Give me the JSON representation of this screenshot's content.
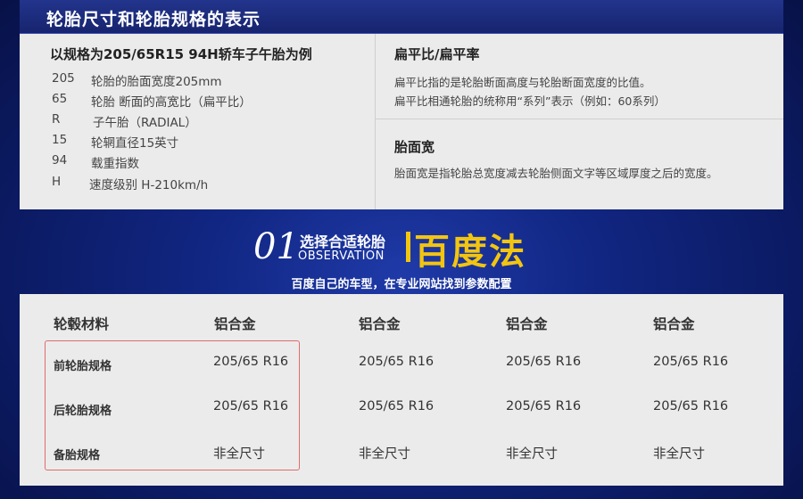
{
  "header": {
    "title": "轮胎尺寸和轮胎规格的表示"
  },
  "example": {
    "title": "以规格为205/65R15 94H轿车子午胎为例",
    "rows": [
      {
        "code": "205",
        "desc": "轮胎的胎面宽度205mm"
      },
      {
        "code": "65",
        "desc": "轮胎 断面的高宽比（扁平比）"
      },
      {
        "code": "R",
        "desc": "子午胎（RADIAL）"
      },
      {
        "code": "15",
        "desc": "轮辋直径15英寸"
      },
      {
        "code": "94",
        "desc": "载重指数"
      },
      {
        "code": "H",
        "desc": "速度级别 H-210km/h"
      }
    ]
  },
  "aspect_ratio": {
    "title": "扁平比/扁平率",
    "lines": [
      "扁平比指的是轮胎断面高度与轮胎断面宽度的比值。",
      "扁平比相通轮胎的统称用“系列”表示（例如：60系列）"
    ]
  },
  "tread_width": {
    "title": "胎面宽",
    "text": "胎面宽是指轮胎总宽度减去轮胎侧面文字等区域厚度之后的宽度。"
  },
  "banner": {
    "number": "01",
    "title_cn": "选择合适轮胎",
    "title_en": "OBSERVATION",
    "highlight": "百度法",
    "subtitle": "百度自己的车型，在专业网站找到参数配置"
  },
  "spec_table": {
    "header": [
      "轮毂材料",
      "铝合金",
      "铝合金",
      "铝合金",
      "铝合金"
    ],
    "rows": [
      {
        "label": "前轮胎规格",
        "values": [
          "205/65 R16",
          "205/65 R16",
          "205/65 R16",
          "205/65 R16"
        ]
      },
      {
        "label": "后轮胎规格",
        "values": [
          "205/65 R16",
          "205/65 R16",
          "205/65 R16",
          "205/65 R16"
        ]
      },
      {
        "label": "备胎规格",
        "values": [
          "非全尺寸",
          "非全尺寸",
          "非全尺寸",
          "非全尺寸"
        ]
      }
    ]
  },
  "colors": {
    "accent_yellow": "#f2c511",
    "highlight_border": "#e06b6b",
    "panel_bg": "#ebebeb"
  }
}
